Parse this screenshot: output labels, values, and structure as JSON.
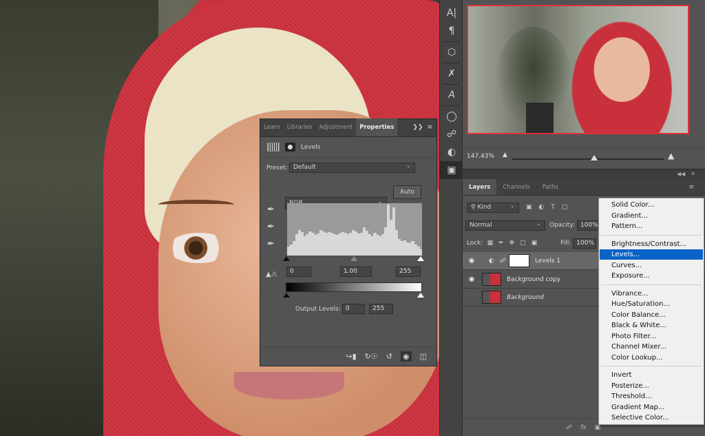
{
  "properties_panel": {
    "tabs": [
      "Learn",
      "Libraries",
      "Adjustment",
      "Properties"
    ],
    "active_tab": "Properties",
    "adjustment_title": "Levels",
    "preset_label": "Preset:",
    "preset_value": "Default",
    "channel_value": "RGB",
    "auto_button": "Auto",
    "input_black": "0",
    "input_gamma": "1.00",
    "input_white": "255",
    "output_label": "Output Levels:",
    "output_black": "0",
    "output_white": "255",
    "collapse_glyph": "❯❯",
    "menu_glyph": "≡",
    "footer_icons": [
      "clip-to-layer-icon",
      "view-previous-icon",
      "reset-icon",
      "visibility-icon",
      "trash-icon"
    ]
  },
  "navigator": {
    "zoom": "147.43%",
    "zoom_slider_level": 0.55
  },
  "layers_panel": {
    "tabs": [
      "Layers",
      "Channels",
      "Paths"
    ],
    "active_tab": "Layers",
    "filter_value": "Kind",
    "blend_mode": "Normal",
    "opacity_label": "Opacity:",
    "opacity_value": "100%",
    "lock_label": "Lock:",
    "fill_label": "Fill:",
    "fill_value": "100%",
    "layers": [
      {
        "name": "Levels 1",
        "visible": true,
        "selected": true
      },
      {
        "name": "Background copy",
        "visible": true,
        "selected": false
      },
      {
        "name": "Background",
        "visible": false,
        "selected": false
      }
    ],
    "footer_fx": "fx"
  },
  "adjustment_menu": {
    "groups": [
      [
        "Solid Color...",
        "Gradient...",
        "Pattern..."
      ],
      [
        "Brightness/Contrast...",
        "Levels...",
        "Curves...",
        "Exposure..."
      ],
      [
        "Vibrance...",
        "Hue/Saturation...",
        "Color Balance...",
        "Black & White...",
        "Photo Filter...",
        "Channel Mixer...",
        "Color Lookup..."
      ],
      [
        "Invert",
        "Posterize...",
        "Threshold...",
        "Gradient Map...",
        "Selective Color..."
      ]
    ],
    "highlighted": "Levels...",
    "highlight_color": "#0a64c8"
  },
  "histogram": [
    0.18,
    0.22,
    0.28,
    0.42,
    0.5,
    0.46,
    0.38,
    0.42,
    0.47,
    0.44,
    0.4,
    0.43,
    0.5,
    0.47,
    0.44,
    0.46,
    0.45,
    0.42,
    0.4,
    0.43,
    0.46,
    0.44,
    0.42,
    0.45,
    0.5,
    0.47,
    0.43,
    0.45,
    0.55,
    0.48,
    0.42,
    0.38,
    0.45,
    0.4,
    0.38,
    0.42,
    0.55,
    1.0,
    0.7,
    0.95,
    0.5,
    0.32,
    0.28,
    0.3,
    0.26,
    0.24,
    0.28,
    0.22,
    0.18,
    0.12
  ]
}
